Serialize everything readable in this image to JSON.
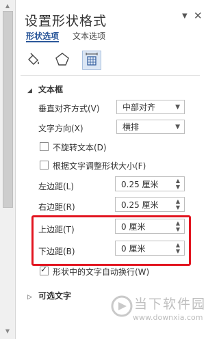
{
  "pane": {
    "title": "设置形状格式",
    "tabs": [
      {
        "label": "形状选项",
        "active": true
      },
      {
        "label": "文本选项",
        "active": false
      }
    ]
  },
  "icons": [
    "fill-line-icon",
    "effects-icon",
    "size-properties-icon"
  ],
  "textbox_section": {
    "title": "文本框",
    "vertical_align": {
      "label": "垂直对齐方式(V)",
      "value": "中部对齐"
    },
    "text_direction": {
      "label": "文字方向(X)",
      "value": "横排"
    },
    "no_rotate": {
      "label": "不旋转文本(D)",
      "checked": false
    },
    "autofit": {
      "label": "根据文字调整形状大小(F)",
      "checked": false
    },
    "left_margin": {
      "label": "左边距(L)",
      "value": "0.25 厘米"
    },
    "right_margin": {
      "label": "右边距(R)",
      "value": "0.25 厘米"
    },
    "top_margin": {
      "label": "上边距(T)",
      "value": "0 厘米"
    },
    "bottom_margin": {
      "label": "下边距(B)",
      "value": "0 厘米"
    },
    "wrap_text": {
      "label": "形状中的文字自动换行(W)",
      "checked": true
    }
  },
  "alt_text_section": {
    "title": "可选文字"
  },
  "watermark": {
    "text": "当下软件园",
    "url": "www.downxia.com"
  },
  "colors": {
    "accent": "#2b579a",
    "highlight": "#e2141f"
  }
}
